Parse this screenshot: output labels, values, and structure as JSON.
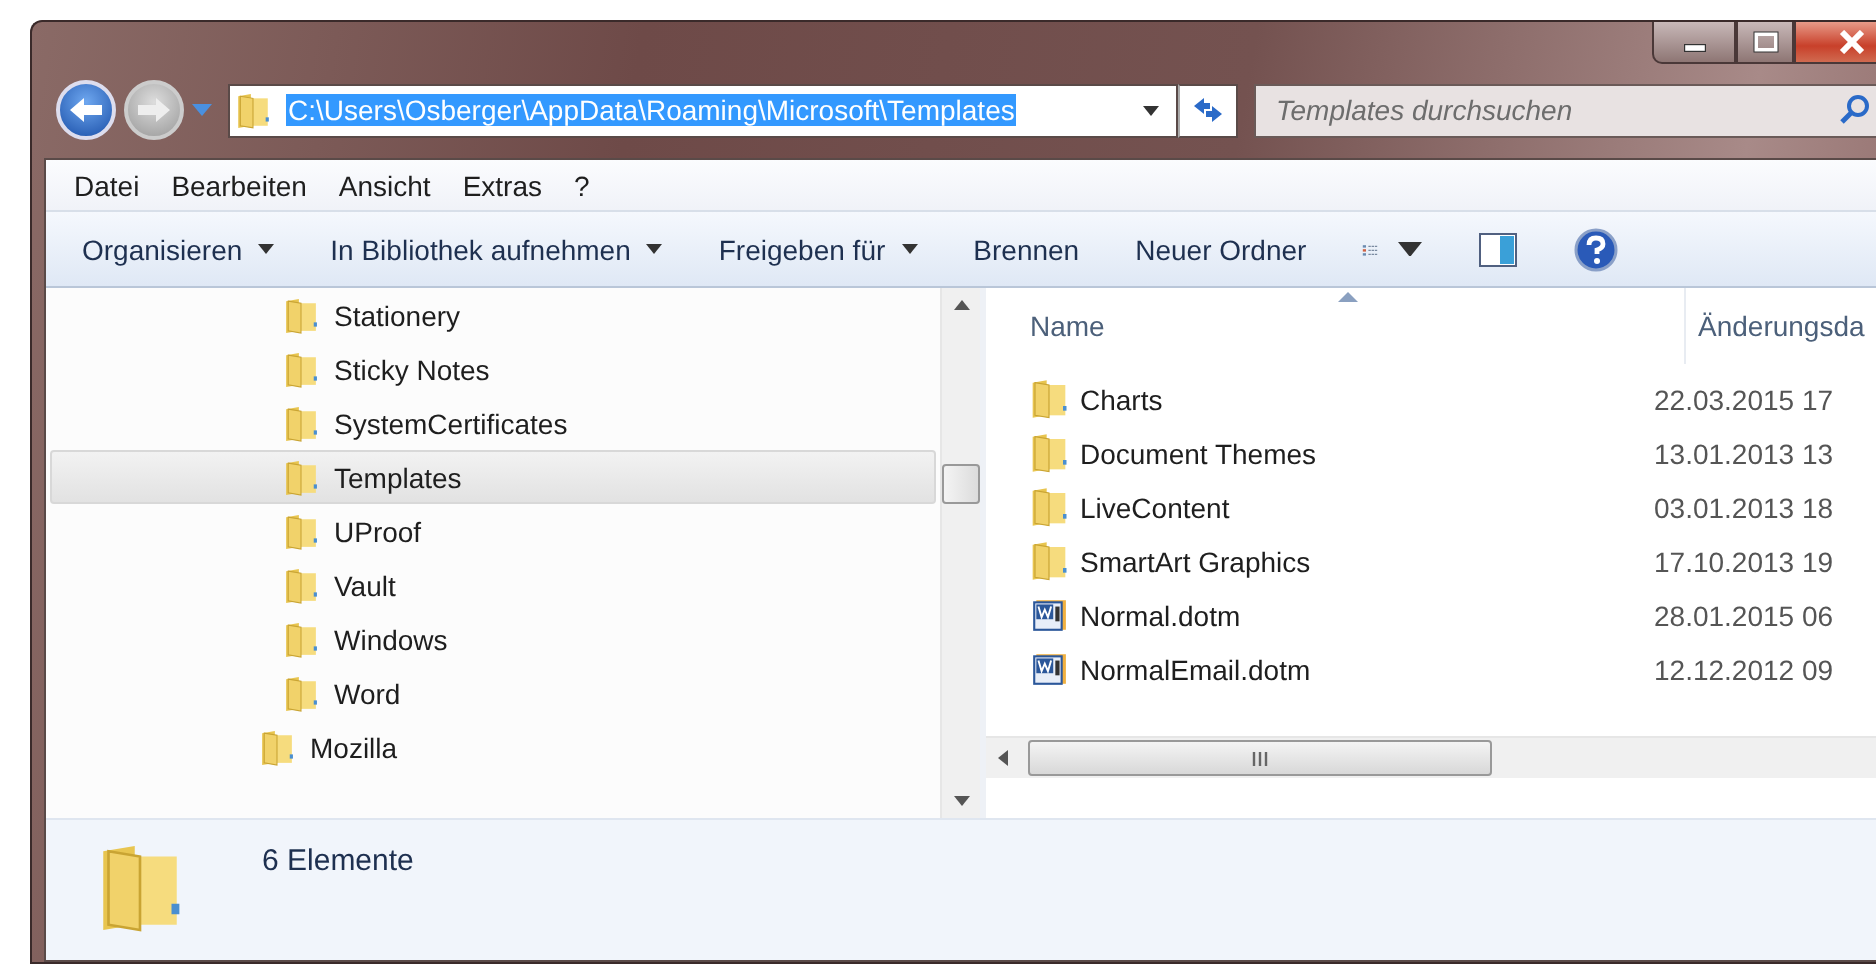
{
  "window": {
    "caption_buttons": [
      {
        "kind": "minimize"
      },
      {
        "kind": "maximize"
      },
      {
        "kind": "close"
      }
    ]
  },
  "address_bar": {
    "path": "C:\\Users\\Osberger\\AppData\\Roaming\\Microsoft\\Templates",
    "path_selected": true
  },
  "search": {
    "placeholder": "Templates durchsuchen"
  },
  "menu": [
    "Datei",
    "Bearbeiten",
    "Ansicht",
    "Extras",
    "?"
  ],
  "toolbar": [
    {
      "kind": "text",
      "label": "Organisieren",
      "has_menu": true
    },
    {
      "kind": "text",
      "label": "In Bibliothek aufnehmen",
      "has_menu": true
    },
    {
      "kind": "text",
      "label": "Freigeben für",
      "has_menu": true
    },
    {
      "kind": "text",
      "label": "Brennen",
      "has_menu": false
    },
    {
      "kind": "text",
      "label": "Neuer Ordner",
      "has_menu": false
    },
    {
      "kind": "views",
      "has_menu": true
    },
    {
      "kind": "preview",
      "has_menu": false
    },
    {
      "kind": "help",
      "has_menu": false
    }
  ],
  "nav_tree": [
    {
      "children": [
        {
          "label": "Stationery",
          "selected": false
        },
        {
          "label": "Sticky Notes",
          "selected": false
        },
        {
          "label": "SystemCertificates",
          "selected": false
        },
        {
          "label": "Templates",
          "selected": true
        },
        {
          "label": "UProof",
          "selected": false
        },
        {
          "label": "Vault",
          "selected": false
        },
        {
          "label": "Windows",
          "selected": false
        },
        {
          "label": "Word",
          "selected": false
        }
      ]
    },
    {
      "label": "Mozilla",
      "selected": false
    }
  ],
  "file_list": {
    "columns": [
      "Name",
      "Änderungsda"
    ],
    "rows": [
      {
        "kind": "folder",
        "name": "Charts",
        "modified": "22.03.2015 17"
      },
      {
        "kind": "folder",
        "name": "Document Themes",
        "modified": "13.01.2013 13"
      },
      {
        "kind": "folder",
        "name": "LiveContent",
        "modified": "03.01.2013 18"
      },
      {
        "kind": "folder",
        "name": "SmartArt Graphics",
        "modified": "17.10.2013 19"
      },
      {
        "kind": "word",
        "name": "Normal.dotm",
        "modified": "28.01.2015 06"
      },
      {
        "kind": "word",
        "name": "NormalEmail.dotm",
        "modified": "12.12.2012 09"
      }
    ]
  },
  "status_bar": {
    "count": "6 Elemente"
  }
}
